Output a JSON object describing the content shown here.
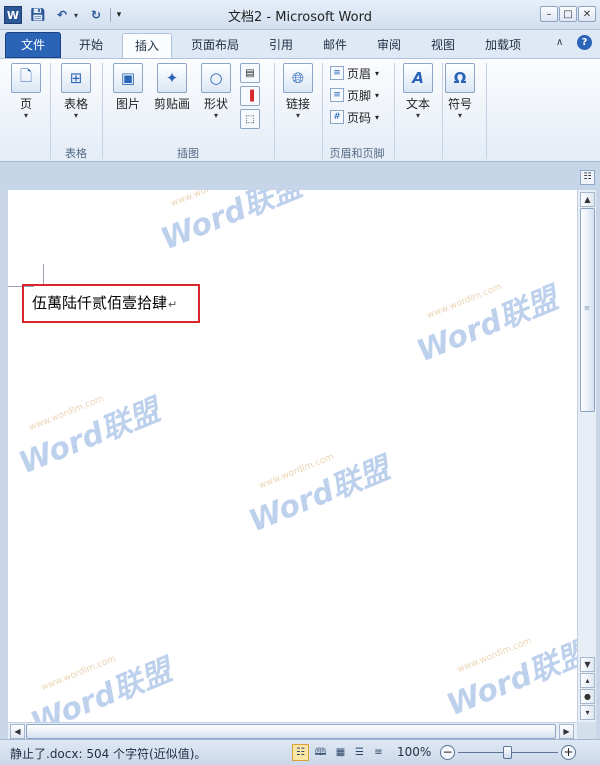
{
  "window": {
    "title": "文档2 - Microsoft Word"
  },
  "quick_access": {
    "logo_glyph": "W",
    "save_icon": "save-icon",
    "undo_icon": "undo-icon",
    "redo_icon": "redo-icon"
  },
  "tabs": {
    "file": "文件",
    "home": "开始",
    "insert": "插入",
    "layout": "页面布局",
    "references": "引用",
    "mailings": "邮件",
    "review": "审阅",
    "view": "视图",
    "addins": "加载项"
  },
  "ribbon": {
    "pages": {
      "label": "页"
    },
    "table": {
      "label": "表格",
      "group": "表格"
    },
    "illustrations": {
      "picture": "图片",
      "clipart": "剪贴画",
      "shapes": "形状",
      "group": "插图"
    },
    "links": {
      "label": "链接"
    },
    "header_footer": {
      "header": "页眉",
      "footer": "页脚",
      "page_number": "页码",
      "group": "页眉和页脚"
    },
    "text": {
      "label": "文本"
    },
    "symbols": {
      "label": "符号"
    }
  },
  "document": {
    "text": "伍萬陆仟贰佰壹拾肆",
    "watermark": "Word联盟",
    "watermark_url": "www.wordlm.com",
    "highlight_color": "#d9262b"
  },
  "status": {
    "message": "静止了.docx: 504 个字符(近似值)。",
    "zoom": "100%"
  },
  "colors": {
    "file_tab": "#2a64b7",
    "accent": "#2b5797"
  }
}
